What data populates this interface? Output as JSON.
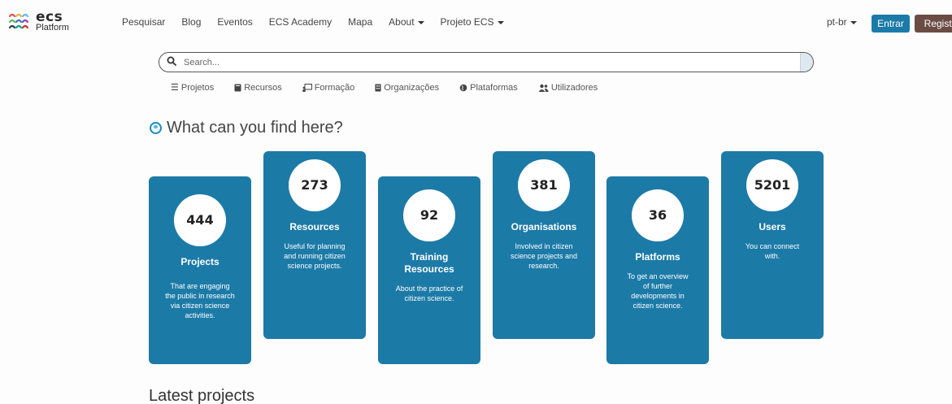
{
  "header": {
    "logo_main": "ecs",
    "logo_sub": "Platform",
    "nav": [
      {
        "label": "Pesquisar",
        "dropdown": false
      },
      {
        "label": "Blog",
        "dropdown": false
      },
      {
        "label": "Eventos",
        "dropdown": false
      },
      {
        "label": "ECS Academy",
        "dropdown": false
      },
      {
        "label": "Mapa",
        "dropdown": false
      },
      {
        "label": "About",
        "dropdown": true
      },
      {
        "label": "Projeto ECS",
        "dropdown": true
      }
    ],
    "language": "pt-br",
    "login_label": "Entrar",
    "register_label": "Registar",
    "login_color": "#1b7ba8",
    "register_color": "#6b4c45"
  },
  "search": {
    "placeholder": "Search..."
  },
  "filters": [
    {
      "label": "Projetos",
      "icon": "list-icon"
    },
    {
      "label": "Recursos",
      "icon": "book-icon"
    },
    {
      "label": "Formação",
      "icon": "chalkboard-icon"
    },
    {
      "label": "Organizações",
      "icon": "building-icon"
    },
    {
      "label": "Plataformas",
      "icon": "globe-icon"
    },
    {
      "label": "Utilizadores",
      "icon": "users-icon"
    }
  ],
  "find_heading": "What can you find here?",
  "cards": [
    {
      "count": "444",
      "title": "Projects",
      "desc": "That are engaging the public in research via citizen science activities."
    },
    {
      "count": "273",
      "title": "Resources",
      "desc": "Useful for planning and running citizen science projects."
    },
    {
      "count": "92",
      "title": "Training Resources",
      "desc": "About the practice of citizen science."
    },
    {
      "count": "381",
      "title": "Organisations",
      "desc": "Involved in citizen science projects and research."
    },
    {
      "count": "36",
      "title": "Platforms",
      "desc": "To get an overview of further developments in citizen science."
    },
    {
      "count": "5201",
      "title": "Users",
      "desc": "You can connect with."
    }
  ],
  "card_color": "#1c7aa7",
  "latest_heading": "Latest projects"
}
